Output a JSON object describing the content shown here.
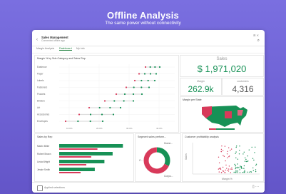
{
  "hero": {
    "title": "Offline Analysis",
    "subtitle": "The same power without connectivity"
  },
  "app": {
    "title": "Sales Management",
    "subtitle": "Connected offline app"
  },
  "tabs": [
    {
      "label": "Margin Analysis",
      "active": false
    },
    {
      "label": "Dashboard",
      "active": true
    },
    {
      "label": "My info",
      "active": false
    }
  ],
  "colors": {
    "accent": "#179156",
    "red": "#d83a5a",
    "purple": "#6b5fcf"
  },
  "margin_chart": {
    "title": "Margin % by Sub-Category and Sales Rep",
    "categories": [
      "Eastmoor",
      "Paper",
      "Labels",
      "Fasteners",
      "Pockets",
      "Binders",
      "Art",
      "Accessories",
      "Envelopes"
    ],
    "x_ticks": [
      "10.0%",
      "20.0%",
      "30.0%",
      "40.0%"
    ]
  },
  "sales_kpi": {
    "label": "Sales",
    "value": "$ 1,971,020"
  },
  "margin_kpi": {
    "label": "Margin",
    "value": "262.9k"
  },
  "customers_kpi": {
    "label": "customers",
    "value": "4,316"
  },
  "map": {
    "title": "Margin per State"
  },
  "sales_by_rep": {
    "title": "Sales by Rep",
    "reps": [
      {
        "name": "Martin Miller",
        "value": 0.93
      },
      {
        "name": "Robert Brown",
        "value": 0.78
      },
      {
        "name": "Linda Wright",
        "value": 0.66
      },
      {
        "name": "Jessie Smith",
        "value": 0.52
      }
    ]
  },
  "segment": {
    "title": "Segment sales perform...",
    "legend_top": "Home...",
    "legend_bottom": "Corpo...",
    "center_label": "C..."
  },
  "profitability": {
    "title": "Customer profitability analysis",
    "ylabel": "Sales",
    "xlabel": "Margin %"
  },
  "footer": {
    "label": "Applied selections"
  }
}
